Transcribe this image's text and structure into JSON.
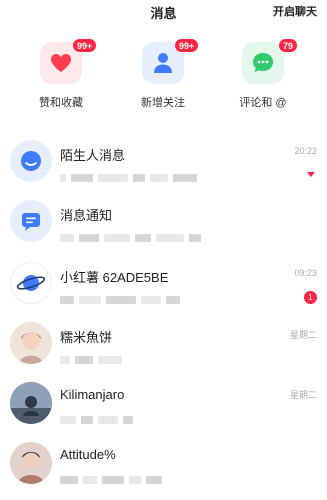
{
  "header": {
    "title": "消息",
    "action_label": "开启聊天"
  },
  "quick_actions": [
    {
      "label": "赞和收藏",
      "badge": "99+",
      "icon": "heart-icon",
      "bg": "#fde9ea",
      "color": "#ff3b4e"
    },
    {
      "label": "新增关注",
      "badge": "99+",
      "icon": "person-icon",
      "bg": "#e7efff",
      "color": "#3d7bff"
    },
    {
      "label": "评论和 @",
      "badge": "79",
      "icon": "chat-bubble-icon",
      "bg": "#e3f7ea",
      "color": "#2fcb6c"
    }
  ],
  "conversations": [
    {
      "name": "陌生人消息",
      "time": "20:22",
      "avatar": "chat-bubble-icon",
      "indicator": "triangle"
    },
    {
      "name": "消息通知",
      "time": "",
      "avatar": "notification-icon",
      "indicator": "none"
    },
    {
      "name": "小红薯 62ADE5BE",
      "time": "09:23",
      "avatar": "planet-icon",
      "indicator": "badge",
      "badge": "1"
    },
    {
      "name": "糯米魚饼",
      "time": "星期二",
      "avatar": "photo-avatar",
      "indicator": "none"
    },
    {
      "name": "Kilimanjaro",
      "time": "星期二",
      "avatar": "photo-avatar",
      "indicator": "none"
    },
    {
      "name": "Attitude%",
      "time": "",
      "avatar": "photo-avatar",
      "indicator": "none"
    }
  ],
  "colors": {
    "accent": "#ff2442",
    "blue": "#3d7bff",
    "green": "#2fcb6c"
  }
}
